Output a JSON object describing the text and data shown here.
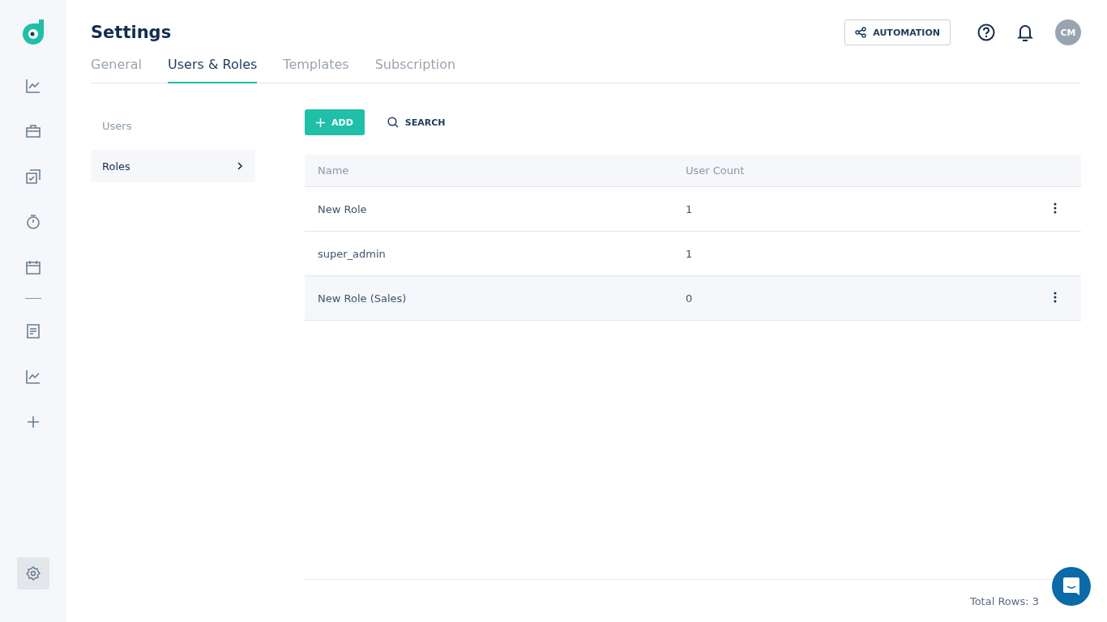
{
  "sidebar": {
    "items": [
      {
        "kind": "chart",
        "selected": false
      },
      {
        "kind": "briefcase",
        "selected": false
      },
      {
        "kind": "tasks",
        "selected": false
      },
      {
        "kind": "timer",
        "selected": false
      },
      {
        "kind": "calendar",
        "selected": false
      },
      {
        "kind": "divider"
      },
      {
        "kind": "document",
        "selected": false
      },
      {
        "kind": "chart",
        "selected": false
      },
      {
        "kind": "plus",
        "selected": false
      }
    ],
    "bottom": {
      "kind": "settings",
      "selected": true
    }
  },
  "header": {
    "title": "Settings",
    "automation_button": "AUTOMATION",
    "avatar": "CM"
  },
  "tabs": [
    {
      "label": "General",
      "selected": false
    },
    {
      "label": "Users & Roles",
      "selected": true
    },
    {
      "label": "Templates",
      "selected": false
    },
    {
      "label": "Subscription",
      "selected": false
    }
  ],
  "subnav": [
    {
      "label": "Users",
      "selected": false
    },
    {
      "label": "Roles",
      "selected": true
    }
  ],
  "toolbar": {
    "add_button": "ADD",
    "search_button": "SEARCH"
  },
  "table": {
    "columns": [
      "Name",
      "User Count"
    ],
    "rows": [
      {
        "name": "New Role",
        "user_count": "1",
        "menu": true,
        "hovered": false
      },
      {
        "name": "super_admin",
        "user_count": "1",
        "menu": false,
        "hovered": false
      },
      {
        "name": "New Role (Sales)",
        "user_count": "0",
        "menu": true,
        "hovered": true
      }
    ]
  },
  "footer": {
    "total_rows": "Total Rows: 3"
  }
}
